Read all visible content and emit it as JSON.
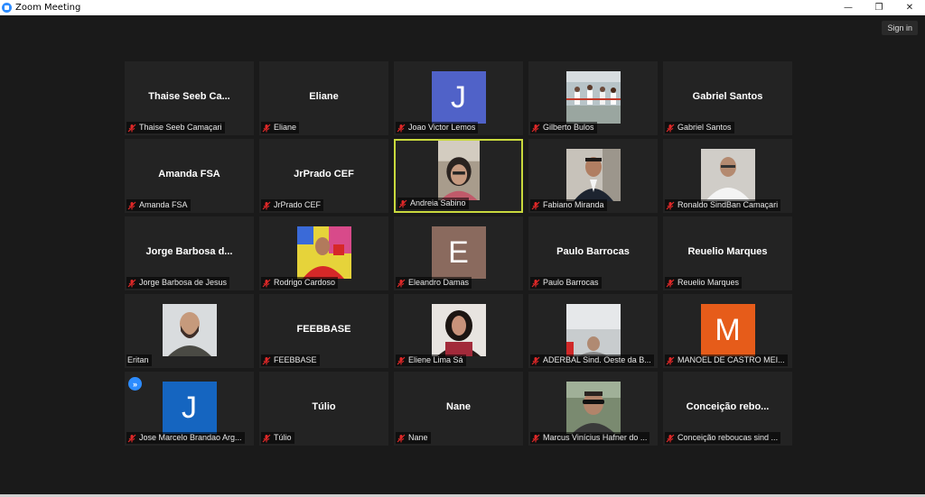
{
  "window": {
    "title": "Zoom Meeting",
    "minimize": "—",
    "restore": "❐",
    "close": "✕"
  },
  "signin_label": "Sign in",
  "colors": {
    "tile_bg": "#232323",
    "active_border": "#c9d93d",
    "mic_muted": "#e02828"
  },
  "participants": [
    {
      "big": "Thaise  Seeb  Ca...",
      "label": "Thaise Seeb Camaçari"
    },
    {
      "big": "Eliane",
      "label": "Eliane"
    },
    {
      "avatar_letter": "J",
      "avatar_color": "#5062c8",
      "label": "Joao Victor Lemos"
    },
    {
      "photo": "karate-class",
      "label": "Gilberto Bulos"
    },
    {
      "big": "Gabriel Santos",
      "label": "Gabriel Santos"
    },
    {
      "big": "Amanda FSA",
      "label": "Amanda FSA"
    },
    {
      "big": "JrPrado CEF",
      "label": "JrPrado CEF"
    },
    {
      "photo": "woman-video",
      "label": "Andreia Sabino"
    },
    {
      "photo": "man-suit",
      "label": "Fabiano Miranda"
    },
    {
      "photo": "man-white-shirt",
      "label": "Ronaldo SindBan Camaçari"
    },
    {
      "big": "Jorge  Barbosa  d...",
      "label": "Jorge Barbosa de Jesus"
    },
    {
      "photo": "man-red-shirt",
      "label": "Rodrigo Cardoso"
    },
    {
      "avatar_letter": "E",
      "avatar_color": "#8a6a5e",
      "label": "Eleandro Damas"
    },
    {
      "big": "Paulo Barrocas",
      "label": "Paulo Barrocas"
    },
    {
      "big": "Reuelio Marques",
      "label": "Reuelio Marques"
    },
    {
      "photo": "bald-man",
      "label": "Eritan"
    },
    {
      "big": "FEEBBASE",
      "label": "FEEBBASE"
    },
    {
      "photo": "woman-dark-hair",
      "label": "Eliene Lima Sá"
    },
    {
      "photo": "man-office",
      "label": "ADERBAL Sind. Oeste da B..."
    },
    {
      "avatar_letter": "M",
      "avatar_color": "#e65c1a",
      "label": "MANOEL DE CASTRO MEI..."
    },
    {
      "avatar_letter": "J",
      "avatar_color": "#1565c0",
      "label": "Jose Marcelo Brandao Arg..."
    },
    {
      "big": "Túlio",
      "label": "Túlio"
    },
    {
      "big": "Nane",
      "label": "Nane"
    },
    {
      "photo": "man-sunglasses",
      "label": "Marcus Vinícius Hafner do ..."
    },
    {
      "big": "Conceição    rebo...",
      "label": "Conceição  reboucas  sind ..."
    }
  ]
}
